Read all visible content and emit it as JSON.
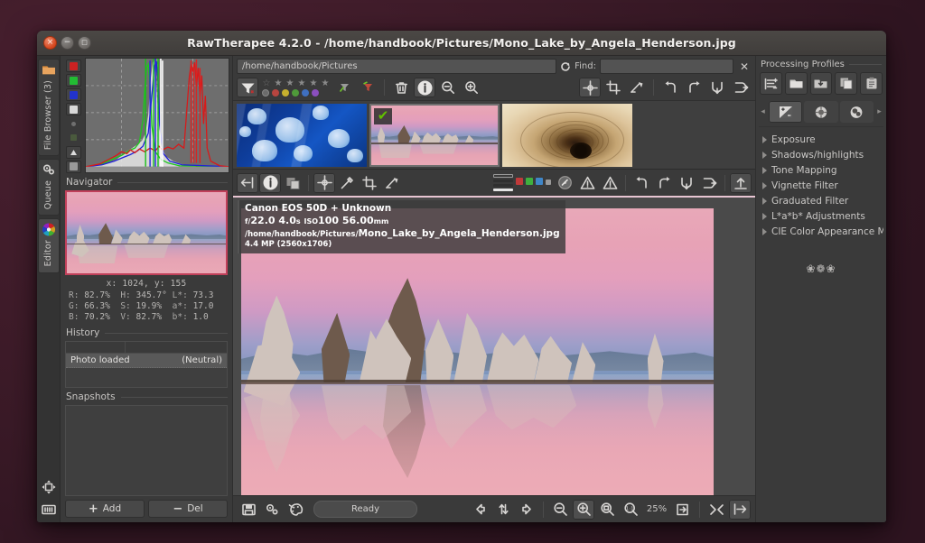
{
  "window": {
    "title": "RawTherapee 4.2.0 - /home/handbook/Pictures/Mono_Lake_by_Angela_Henderson.jpg",
    "close_glyph": "×",
    "minimize_glyph": "−",
    "maximize_glyph": "□"
  },
  "vertical_tabs": [
    {
      "label": "File Browser (3)",
      "icon": "folder-icon",
      "active": false
    },
    {
      "label": "Queue",
      "icon": "gears-icon",
      "active": false
    },
    {
      "label": "Editor",
      "icon": "color-wheel-icon",
      "active": true
    }
  ],
  "vertical_bottom_icons": [
    {
      "name": "move-resize-icon"
    },
    {
      "name": "keyboard-icon"
    }
  ],
  "left_panel": {
    "histogram_toggles": [
      {
        "name": "histogram-red-toggle",
        "color": "#cc2222"
      },
      {
        "name": "histogram-green-toggle",
        "color": "#22bb33"
      },
      {
        "name": "histogram-blue-toggle",
        "color": "#2233cc"
      },
      {
        "name": "histogram-luminance-toggle",
        "color": "#d8d8d8"
      },
      {
        "name": "histogram-chroma-toggle",
        "color": "#7a7a7a"
      },
      {
        "name": "histogram-raw-toggle",
        "color": "#5e7a5e"
      },
      {
        "name": "histogram-mode-toggle",
        "color": "#d8d8d8"
      },
      {
        "name": "histogram-bar-toggle",
        "color": "#9a9a9a"
      }
    ],
    "navigator_title": "Navigator",
    "navigator": {
      "xy": "x:  1024,  y:  155",
      "rows": [
        {
          "c1_label": "R:",
          "c1_value": "82.7%",
          "c2_label": "H:",
          "c2_value": "345.7°",
          "c3_label": "L*:",
          "c3_value": "73.3"
        },
        {
          "c1_label": "G:",
          "c1_value": "66.3%",
          "c2_label": "S:",
          "c2_value": "19.9%",
          "c3_label": "a*:",
          "c3_value": "17.0"
        },
        {
          "c1_label": "B:",
          "c1_value": "70.2%",
          "c2_label": "V:",
          "c2_value": "82.7%",
          "c3_label": "b*:",
          "c3_value": "1.0"
        }
      ]
    },
    "history_title": "History",
    "history_rows": [
      {
        "action": "Photo loaded",
        "value": "(Neutral)"
      }
    ],
    "snapshots_title": "Snapshots",
    "snapshot_buttons": [
      {
        "label": "Add",
        "sign": "+",
        "name": "snapshot-add-button"
      },
      {
        "label": "Del",
        "sign": "−",
        "name": "snapshot-del-button"
      }
    ]
  },
  "browser": {
    "path_value": "/home/handbook/Pictures",
    "find_label": "Find:",
    "find_value": "",
    "find_placeholder": "",
    "refresh_icon": "refresh-icon",
    "clear_find_glyph": "✕",
    "toolbar": [
      {
        "name": "filter-funnel-button",
        "icon": "funnel-icon",
        "active": true
      },
      {
        "name": "trash-button",
        "icon": "trash-icon",
        "active": false
      },
      {
        "name": "info-button",
        "icon": "info-icon",
        "active": true
      },
      {
        "name": "zoom-out-button",
        "icon": "zoom-out-icon",
        "active": false
      },
      {
        "name": "zoom-in-button",
        "icon": "zoom-in-icon",
        "active": false
      }
    ],
    "right_toolbar": [
      {
        "name": "move-tool-button",
        "icon": "crosshair-icon",
        "active": true
      },
      {
        "name": "crop-tool-button",
        "icon": "crop-icon",
        "active": false
      },
      {
        "name": "straighten-tool-button",
        "icon": "straighten-icon",
        "active": false
      },
      {
        "name": "rotate-left-button",
        "icon": "rotate-left-icon",
        "active": false
      },
      {
        "name": "rotate-right-button",
        "icon": "rotate-right-icon",
        "active": false
      },
      {
        "name": "flip-vertical-button",
        "icon": "flip-vertical-icon",
        "active": false
      },
      {
        "name": "flip-horizontal-button",
        "icon": "flip-horizontal-icon",
        "active": false
      }
    ],
    "rating_stars": 5,
    "color_labels": [
      "#b8453f",
      "#c6b02e",
      "#4f9a3a",
      "#3f6fbf",
      "#8b4fbf"
    ],
    "thumbnails": [
      {
        "name": "thumbnail-jellyfish",
        "selected": false,
        "checked": false,
        "scene": "jelly"
      },
      {
        "name": "thumbnail-mono-lake",
        "selected": true,
        "checked": true,
        "scene": "mono"
      },
      {
        "name": "thumbnail-spiral",
        "selected": false,
        "checked": false,
        "scene": "spiral"
      }
    ]
  },
  "editor_toolbar": [
    {
      "name": "hide-panel-button",
      "icon": "collapse-left-icon",
      "active": true
    },
    {
      "name": "info-button",
      "icon": "info-icon",
      "active": true
    },
    {
      "name": "before-after-button",
      "icon": "before-after-icon",
      "active": false
    },
    {
      "name": "hand-tool-button",
      "icon": "crosshair-icon",
      "active": true
    },
    {
      "name": "white-balance-picker-button",
      "icon": "eyedropper-icon",
      "active": false
    },
    {
      "name": "crop-tool-button",
      "icon": "crop-icon",
      "active": false
    },
    {
      "name": "straighten-tool-button",
      "icon": "straighten-icon",
      "active": false
    },
    {
      "name": "gamut-warning-button",
      "icon": "gauge-icon",
      "active": false
    },
    {
      "name": "shadow-clipping-button",
      "icon": "warning-icon",
      "active": false
    },
    {
      "name": "highlight-clipping-button",
      "icon": "warning-icon",
      "active": false
    },
    {
      "name": "rotate-left-button",
      "icon": "rotate-left-icon",
      "active": false
    },
    {
      "name": "rotate-right-button",
      "icon": "rotate-right-icon",
      "active": false
    },
    {
      "name": "flip-vertical-button",
      "icon": "flip-vertical-icon",
      "active": false
    },
    {
      "name": "flip-horizontal-button",
      "icon": "flip-horizontal-icon",
      "active": false
    },
    {
      "name": "show-bottom-panel-button",
      "icon": "collapse-bottom-icon",
      "active": true
    }
  ],
  "indicator_squares": [
    "#c03a3a",
    "#3fb03f",
    "#3f86c8",
    "#9a9a9a"
  ],
  "exif_overlay": {
    "camera": "Canon EOS 50D + Unknown",
    "aperture_prefix": "f/",
    "aperture": "22.0",
    "shutter": "4.0",
    "shutter_unit": "s",
    "iso_prefix": "ISO",
    "iso": "100",
    "focal": "56.00",
    "focal_unit": "mm",
    "path_prefix": "/home/handbook/Pictures/",
    "filename": "Mono_Lake_by_Angela_Henderson.jpg",
    "dimensions": "4.4 MP (2560x1706)"
  },
  "bottom_bar": {
    "left_buttons": [
      {
        "name": "save-image-button",
        "icon": "save-icon"
      },
      {
        "name": "queue-image-button",
        "icon": "queue-icon"
      },
      {
        "name": "edit-external-button",
        "icon": "palette-icon"
      }
    ],
    "status": "Ready",
    "nav_buttons": [
      {
        "name": "previous-image-button",
        "icon": "arrow-left-icon"
      },
      {
        "name": "sync-filmstrip-button",
        "icon": "sync-icon"
      },
      {
        "name": "next-image-button",
        "icon": "arrow-right-icon"
      }
    ],
    "zoom_buttons": [
      {
        "name": "zoom-out-button",
        "icon": "zoom-out-icon",
        "active": false
      },
      {
        "name": "zoom-in-button",
        "icon": "zoom-in-icon",
        "active": true
      },
      {
        "name": "zoom-fit-button",
        "icon": "zoom-fit-icon",
        "active": false
      },
      {
        "name": "zoom-100-button",
        "icon": "zoom-100-icon",
        "active": false
      }
    ],
    "zoom_level": "25%",
    "right_buttons": [
      {
        "name": "detail-window-button",
        "icon": "detail-window-icon"
      },
      {
        "name": "fullscreen-button",
        "icon": "fullscreen-icon"
      },
      {
        "name": "show-right-panel-button",
        "icon": "collapse-right-icon",
        "active": true
      }
    ]
  },
  "right_panel": {
    "title": "Processing Profiles",
    "profile_buttons": [
      {
        "name": "profile-list-button",
        "icon": "profile-list-icon"
      },
      {
        "name": "load-profile-button",
        "icon": "folder-open-icon"
      },
      {
        "name": "save-profile-button",
        "icon": "save-profile-icon"
      },
      {
        "name": "copy-profile-button",
        "icon": "copy-icon"
      },
      {
        "name": "paste-profile-button",
        "icon": "paste-icon"
      }
    ],
    "tool_tabs": [
      {
        "name": "tab-exposure",
        "icon": "exposure-icon",
        "active": true
      },
      {
        "name": "tab-detail",
        "icon": "detail-icon",
        "active": false
      },
      {
        "name": "tab-color",
        "icon": "color-icon",
        "active": false
      }
    ],
    "tab_prev_glyph": "◂",
    "tab_next_glyph": "▸",
    "tools": [
      {
        "label": "Exposure",
        "name": "tool-exposure"
      },
      {
        "label": "Shadows/highlights",
        "name": "tool-shadows-highlights"
      },
      {
        "label": "Tone Mapping",
        "name": "tool-tone-mapping"
      },
      {
        "label": "Vignette Filter",
        "name": "tool-vignette-filter"
      },
      {
        "label": "Graduated Filter",
        "name": "tool-graduated-filter"
      },
      {
        "label": "L*a*b* Adjustments",
        "name": "tool-lab-adjustments"
      },
      {
        "label": "CIE Color Appearance M",
        "name": "tool-cie-color-appearance"
      }
    ],
    "decoration": "❀❁❀"
  }
}
